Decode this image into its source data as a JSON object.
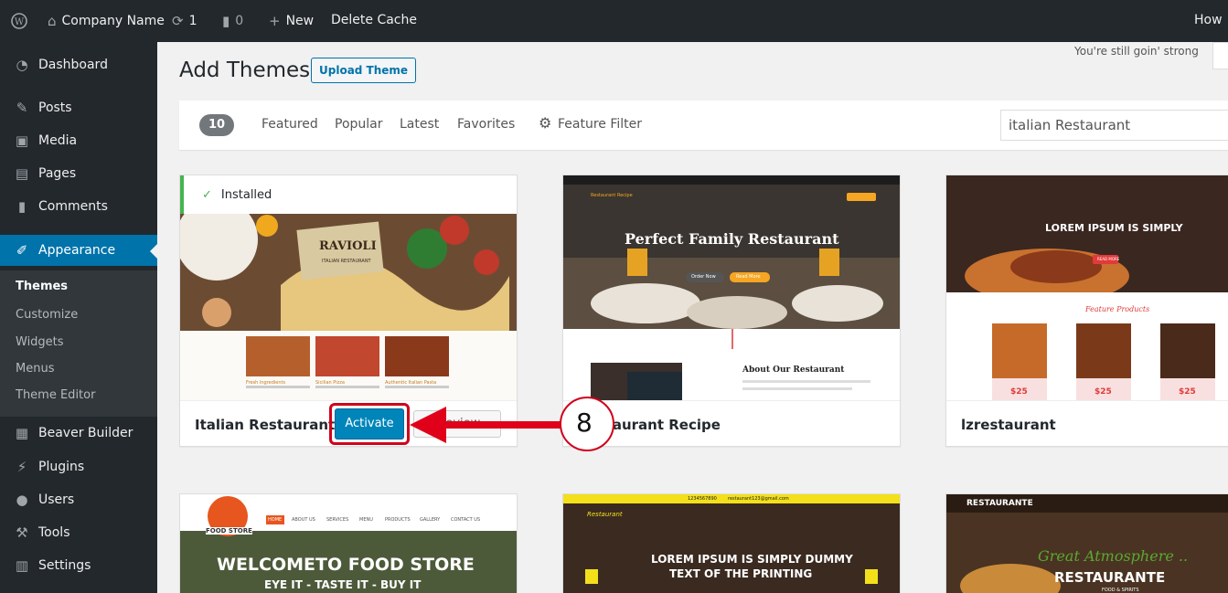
{
  "admin_bar": {
    "site_name": "Company Name",
    "updates_count": "1",
    "comments_count": "0",
    "new_label": "New",
    "delete_cache_label": "Delete Cache",
    "howdy": "How"
  },
  "sidebar": {
    "items": [
      {
        "label": "Dashboard"
      },
      {
        "label": "Posts"
      },
      {
        "label": "Media"
      },
      {
        "label": "Pages"
      },
      {
        "label": "Comments"
      },
      {
        "label": "Appearance"
      },
      {
        "label": "Beaver Builder"
      },
      {
        "label": "Plugins"
      },
      {
        "label": "Users"
      },
      {
        "label": "Tools"
      },
      {
        "label": "Settings"
      }
    ],
    "appearance_submenu": [
      "Themes",
      "Customize",
      "Widgets",
      "Menus",
      "Theme Editor"
    ]
  },
  "page": {
    "title": "Add Themes",
    "upload_label": "Upload Theme",
    "greeting": "You're still goin' strong"
  },
  "filter": {
    "count": "10",
    "links": [
      "Featured",
      "Popular",
      "Latest",
      "Favorites",
      "Feature Filter"
    ],
    "search_value": "italian Restaurant"
  },
  "themes": [
    {
      "name": "Italian Restaurant",
      "installed_label": "Installed",
      "activate_label": "Activate",
      "preview_label": "Preview",
      "shot": {
        "hero": "RAVIOLI",
        "hero_sub": "ITALIAN RESTAURANT",
        "captions": [
          "Fresh Ingredients",
          "Sicilian Pizza",
          "Authentic Italian Pasta"
        ]
      }
    },
    {
      "name": "Restaurant Recipe",
      "shot": {
        "brand": "Restaurant Recipe",
        "hero": "Perfect Family Restaurant",
        "btn1": "Order Now",
        "btn2": "Read More",
        "about": "About Our Restaurant"
      }
    },
    {
      "name": "lzrestaurant",
      "shot": {
        "hero": "LOREM IPSUM IS SIMPLY",
        "btn": "READ MORE",
        "section": "Feature Products",
        "prices": [
          "$25",
          "$25",
          "$25"
        ]
      }
    },
    {
      "shot": {
        "logo": "FOOD STORE",
        "nav": [
          "HOME",
          "ABOUT US",
          "SERVICES",
          "MENU",
          "PRODUCTS",
          "GALLERY",
          "CONTACT US"
        ],
        "hero": "WELCOMETO FOOD STORE",
        "hero_sub": "EYE IT - TASTE IT - BUY IT"
      }
    },
    {
      "shot": {
        "phone": "1234567890",
        "email": "restaurant123@gmail.com",
        "brand": "Restaurant",
        "hero": "LOREM IPSUM IS SIMPLY DUMMY",
        "hero_sub": "TEXT OF THE PRINTING"
      }
    },
    {
      "shot": {
        "brand": "RESTAURANTE",
        "script": "Great Atmosphere ..",
        "hero": "RESTAURANTE",
        "hero_sub": "FOOD & SPIRITS"
      }
    }
  ],
  "annotation": {
    "step": "8"
  }
}
